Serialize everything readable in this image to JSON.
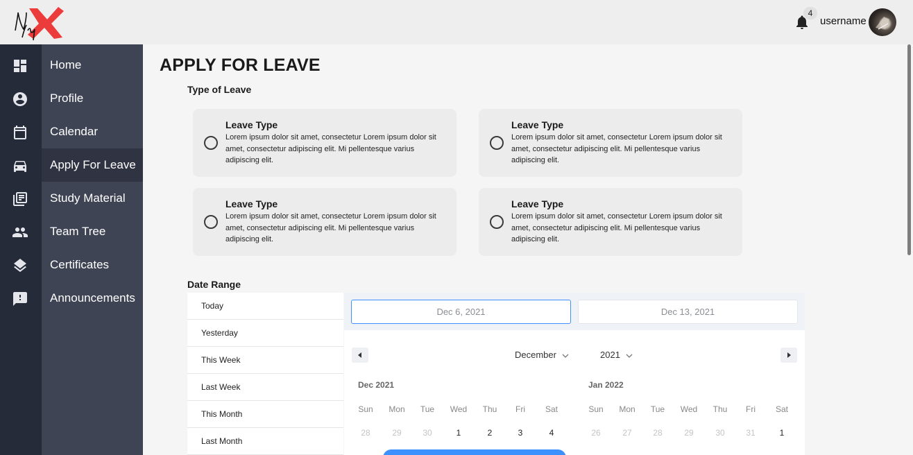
{
  "app": {
    "logo_text": "Ncy"
  },
  "header": {
    "notification_count": "4",
    "username": "username"
  },
  "sidebar": {
    "items": [
      {
        "label": "Home",
        "icon": "dashboard-icon",
        "active": false
      },
      {
        "label": "Profile",
        "icon": "account-circle-icon",
        "active": false
      },
      {
        "label": "Calendar",
        "icon": "calendar-icon",
        "active": false
      },
      {
        "label": "Apply For Leave",
        "icon": "car-icon",
        "active": true
      },
      {
        "label": "Study Material",
        "icon": "library-books-icon",
        "active": false
      },
      {
        "label": "Team Tree",
        "icon": "people-icon",
        "active": false
      },
      {
        "label": "Certificates",
        "icon": "layers-icon",
        "active": false
      },
      {
        "label": "Announcements",
        "icon": "feedback-icon",
        "active": false
      }
    ]
  },
  "page": {
    "title": "APPLY FOR LEAVE",
    "type_of_leave_label": "Type of Leave",
    "leave_types": [
      {
        "title": "Leave Type",
        "description": "Lorem ipsum dolor sit amet, consectetur Lorem ipsum dolor sit amet, consectetur adipiscing elit. Mi pellentesque varius adipiscing elit."
      },
      {
        "title": "Leave Type",
        "description": "Lorem ipsum dolor sit amet, consectetur Lorem ipsum dolor sit amet, consectetur adipiscing elit. Mi pellentesque varius adipiscing elit."
      },
      {
        "title": "Leave Type",
        "description": "Lorem ipsum dolor sit amet, consectetur Lorem ipsum dolor sit amet, consectetur adipiscing elit. Mi pellentesque varius adipiscing elit."
      },
      {
        "title": "Leave Type",
        "description": "Lorem ipsum dolor sit amet, consectetur Lorem ipsum dolor sit amet, consectetur adipiscing elit. Mi pellentesque varius adipiscing elit."
      }
    ],
    "date_range_label": "Date Range"
  },
  "date_range": {
    "start_date": "Dec 6, 2021",
    "end_date": "Dec 13, 2021",
    "presets": [
      "Today",
      "Yesterday",
      "This Week",
      "Last Week",
      "This Month",
      "Last Month"
    ],
    "selected_month": "December",
    "selected_year": "2021",
    "weekdays": [
      "Sun",
      "Mon",
      "Tue",
      "Wed",
      "Thu",
      "Fri",
      "Sat"
    ],
    "months": [
      {
        "label": "Dec 2021",
        "first_row": [
          {
            "d": "28",
            "passive": true
          },
          {
            "d": "29",
            "passive": true
          },
          {
            "d": "30",
            "passive": true
          },
          {
            "d": "1",
            "passive": false
          },
          {
            "d": "2",
            "passive": false
          },
          {
            "d": "3",
            "passive": false
          },
          {
            "d": "4",
            "passive": false
          }
        ]
      },
      {
        "label": "Jan 2022",
        "first_row": [
          {
            "d": "26",
            "passive": true
          },
          {
            "d": "27",
            "passive": true
          },
          {
            "d": "28",
            "passive": true
          },
          {
            "d": "29",
            "passive": true
          },
          {
            "d": "30",
            "passive": true
          },
          {
            "d": "31",
            "passive": true
          },
          {
            "d": "1",
            "passive": false
          }
        ]
      }
    ],
    "accent_color": "#3d91ff"
  },
  "colors": {
    "rail": "#262b3a",
    "nav_panel": "#3f4455",
    "nav_active": "#2f3342",
    "card_bg": "#ececec"
  }
}
